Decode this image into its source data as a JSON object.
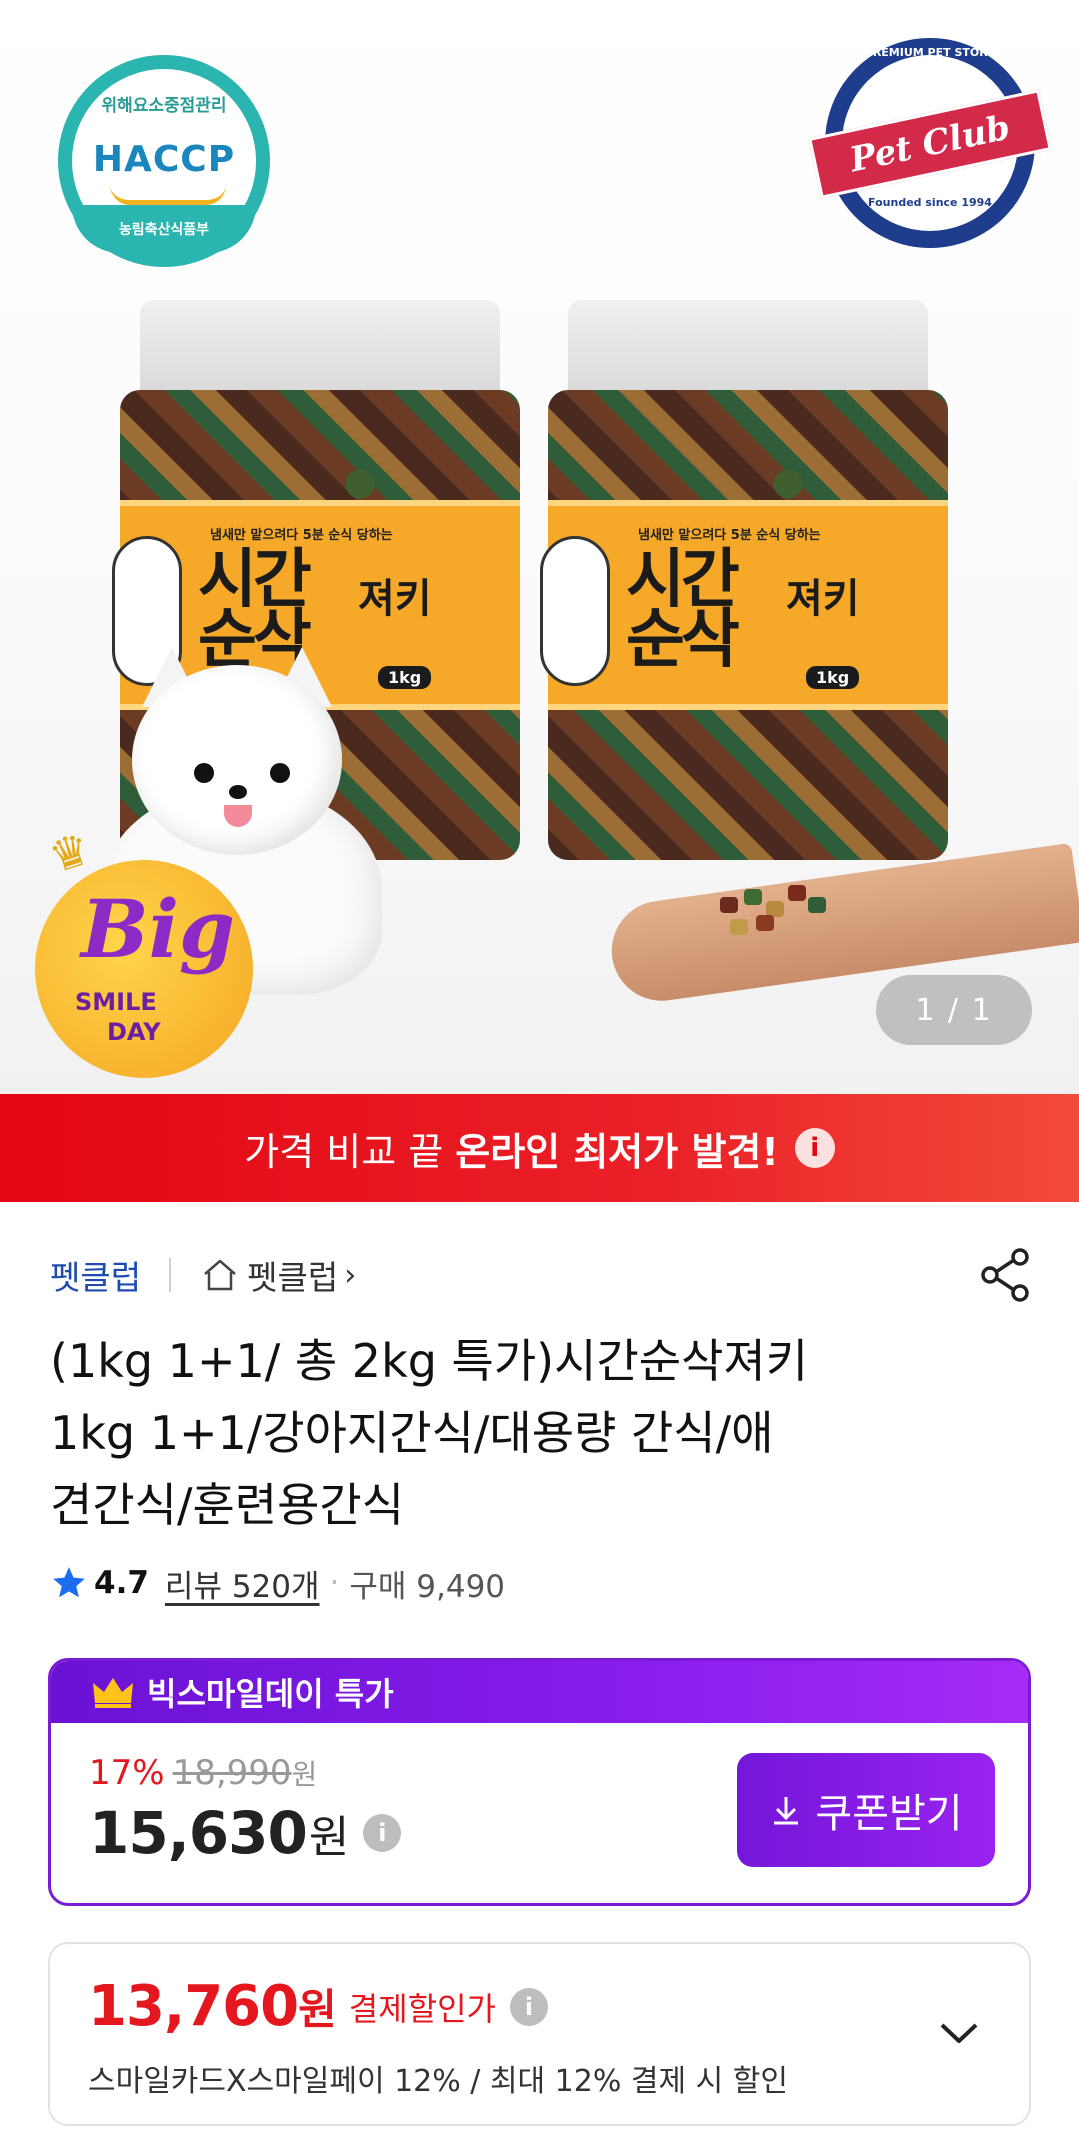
{
  "hero": {
    "haccp": {
      "top": "위해요소중점관리",
      "main": "HACCP",
      "bottom": "농림축산식품부"
    },
    "petclub": {
      "top_text": "PREMIUM PET STORE",
      "name": "Pet Club",
      "bottom_text": "Founded since 1994"
    },
    "jar_label": {
      "sub": "냄새만 맡으려다 5분 순식 당하는",
      "main_line1": "시간",
      "main_line2": "순삭",
      "jerky": "져키",
      "weight": "1kg"
    },
    "badge": {
      "big": "Big",
      "smile": "SMILE",
      "day": "DAY"
    },
    "counter": "1 / 1"
  },
  "banner": {
    "light": "가격 비교 끝",
    "bold": "온라인 최저가 발견!",
    "info": "i"
  },
  "seller": {
    "name": "펫클럽",
    "store": "펫클럽"
  },
  "product": {
    "title_line1": "(1kg 1+1/ 총 2kg 특가)시간순삭져키",
    "title_line2": "1kg 1+1/강아지간식/대용량 간식/애",
    "title_line3": "견간식/훈련용간식"
  },
  "rating": {
    "value": "4.7",
    "reviews": "리뷰 520개",
    "dot": "·",
    "purchases": "구매 9,490"
  },
  "deal": {
    "header": "빅스마일데이 특가",
    "discount": "17%",
    "original_price": "18,990",
    "original_unit": "원",
    "price": "15,630",
    "price_unit": "원",
    "info": "i",
    "coupon_button": "쿠폰받기"
  },
  "payment": {
    "price": "13,760",
    "unit": "원",
    "label": "결제할인가",
    "info": "i",
    "description": "스마일카드X스마일페이 12% / 최대 12% 결제 시 할인"
  },
  "colors": {
    "accent_purple": "#7a1cd6",
    "banner_red": "#e30613",
    "price_red": "#e3171d",
    "seller_blue": "#1e4bb0",
    "star_blue": "#1a6cf0"
  }
}
